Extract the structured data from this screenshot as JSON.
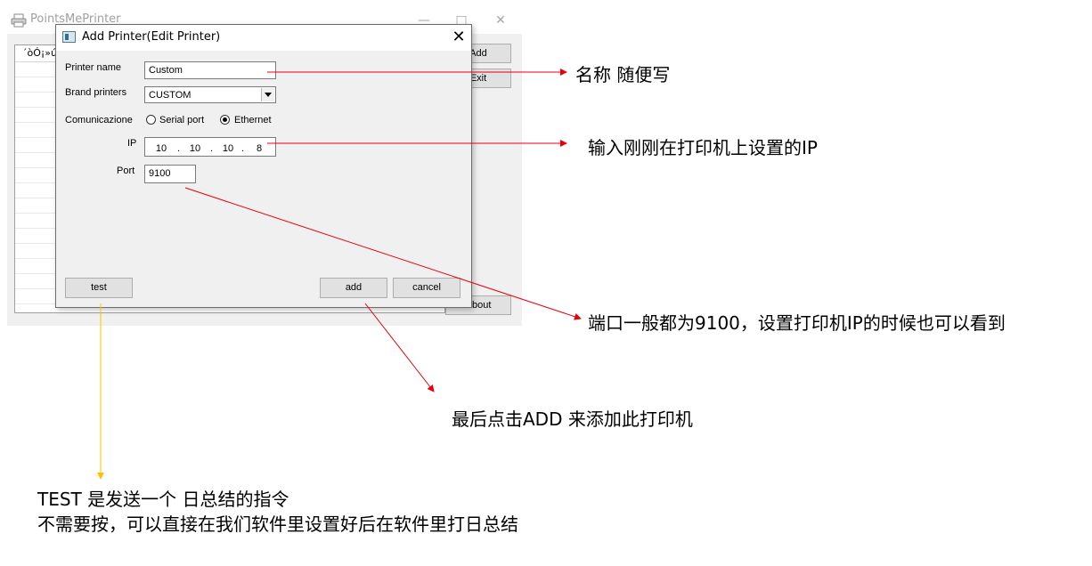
{
  "main_window": {
    "title": "PointsMePrinter",
    "minimize": "—",
    "maximize": "□",
    "close": "✕",
    "list_header": "´òÓ¡»ú",
    "buttons": {
      "add": "Add",
      "exit": "Exit",
      "about": "About"
    }
  },
  "dialog": {
    "title": "Add Printer(Edit Printer)",
    "close": "✕",
    "printer_name_label": "Printer name",
    "printer_name_value": "Custom",
    "brand_label": "Brand printers",
    "brand_value": "CUSTOM",
    "comm_label": "Comunicazione",
    "comm_options": [
      "Serial port",
      "Ethernet"
    ],
    "comm_selected": "Ethernet",
    "ip_label": "IP",
    "ip_octets": [
      "10",
      "10",
      "10",
      "8"
    ],
    "ip_sep": ".",
    "port_label": "Port",
    "port_value": "9100",
    "buttons": {
      "test": "test",
      "add": "add",
      "cancel": "cancel"
    }
  },
  "annotations": {
    "name": "名称 随便写",
    "ip": "输入刚刚在打印机上设置的IP",
    "port": "端口一般都为9100，设置打印机IP的时候也可以看到",
    "add": "最后点击ADD 来添加此打印机",
    "test_line1": "TEST 是发送一个 日总结的指令",
    "test_line2": "不需要按，可以直接在我们软件里设置好后在软件里打日总结"
  },
  "colors": {
    "arrow_red": "#e8000b",
    "arrow_yellow": "#ffc000",
    "dialog_bg": "#f0f0f0",
    "button_bg": "#e1e1e1"
  }
}
